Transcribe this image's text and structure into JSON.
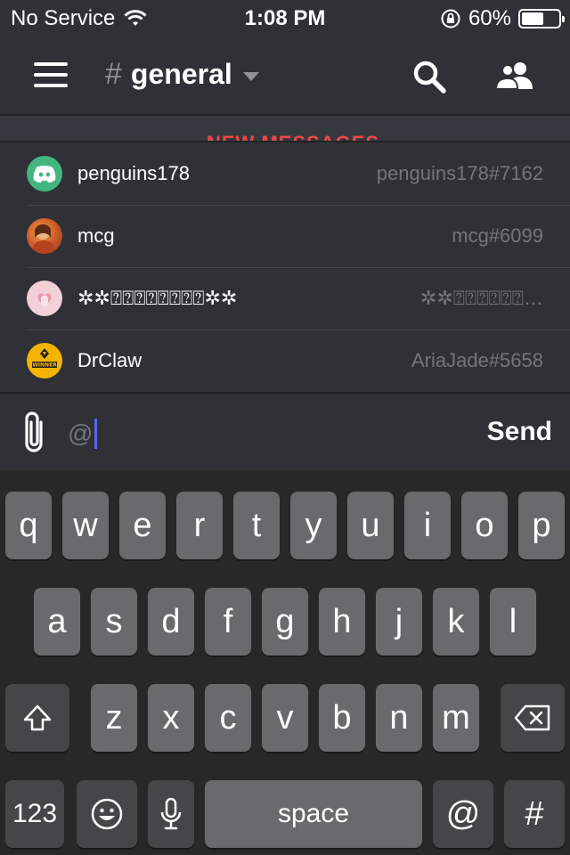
{
  "status": {
    "carrier": "No Service",
    "time": "1:08 PM",
    "battery": "60%",
    "battery_level": 0.6
  },
  "header": {
    "hash": "#",
    "channel": "general"
  },
  "banner": "NEW MESSAGES",
  "mentions": [
    {
      "name": "penguins178",
      "tag": "penguins178#7162"
    },
    {
      "name": "mcg",
      "tag": "mcg#6099"
    },
    {
      "name": "✲✲⍰⍰⍰⍰⍰⍰⍰⍰✲✲",
      "tag": "✲✲⍰⍰⍰⍰⍰⍰…"
    },
    {
      "name": "DrClaw",
      "tag": "AriaJade#5658"
    }
  ],
  "composer": {
    "value": "@",
    "send_label": "Send"
  },
  "keyboard": {
    "row1": [
      "q",
      "w",
      "e",
      "r",
      "t",
      "y",
      "u",
      "i",
      "o",
      "p"
    ],
    "row2": [
      "a",
      "s",
      "d",
      "f",
      "g",
      "h",
      "j",
      "k",
      "l"
    ],
    "row3": [
      "z",
      "x",
      "c",
      "v",
      "b",
      "n",
      "m"
    ],
    "numbers": "123",
    "space": "space",
    "at": "@",
    "hash": "#"
  },
  "avatar_badge": "WINNER",
  "colors": {
    "background": "#2f3136",
    "discord_green": "#43b581",
    "mention_accent": "#f04747",
    "caret": "#5865f2"
  }
}
